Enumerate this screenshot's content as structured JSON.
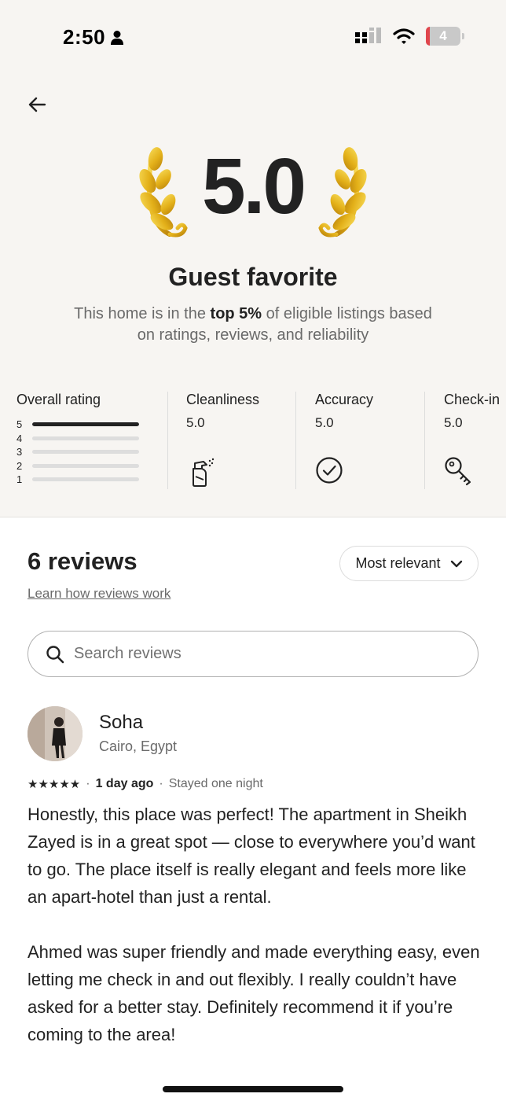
{
  "status_bar": {
    "time": "2:50",
    "battery": "4"
  },
  "header": {
    "rating": "5.0",
    "title": "Guest favorite",
    "desc_pre": "This home is in the ",
    "desc_bold": "top 5%",
    "desc_post": " of eligible listings based on ratings, reviews, and reliability"
  },
  "overall": {
    "label": "Overall rating",
    "rows": [
      {
        "star": "5",
        "fraction": 1.0
      },
      {
        "star": "4",
        "fraction": 0.0
      },
      {
        "star": "3",
        "fraction": 0.0
      },
      {
        "star": "2",
        "fraction": 0.0
      },
      {
        "star": "1",
        "fraction": 0.0
      }
    ]
  },
  "categories": [
    {
      "label": "Cleanliness",
      "value": "5.0",
      "icon": "spray-bottle-icon"
    },
    {
      "label": "Accuracy",
      "value": "5.0",
      "icon": "check-circle-icon"
    },
    {
      "label": "Check-in",
      "value": "5.0",
      "icon": "key-icon"
    }
  ],
  "reviews": {
    "count_label": "6 reviews",
    "learn_link": "Learn how reviews work",
    "sort_label": "Most relevant",
    "search_placeholder": "Search reviews"
  },
  "review": {
    "name": "Soha",
    "location": "Cairo, Egypt",
    "stars": "★★★★★",
    "date": "1 day ago",
    "stay": "Stayed one night",
    "paragraphs": [
      "Honestly, this place was perfect! The apartment in Sheikh Zayed is in a great spot — close to everywhere you’d want to go. The place itself is really elegant and feels more like an apart-hotel than just a rental.",
      "Ahmed was super friendly and made everything easy, even letting me check in and out flexibly. I really couldn’t have asked for a better stay. Definitely recommend it if you’re coming to the area!"
    ]
  },
  "colors": {
    "laurel_gold": "#e3b019",
    "text": "#222222",
    "muted": "#6a6a6a",
    "panel": "#f7f5f2"
  }
}
